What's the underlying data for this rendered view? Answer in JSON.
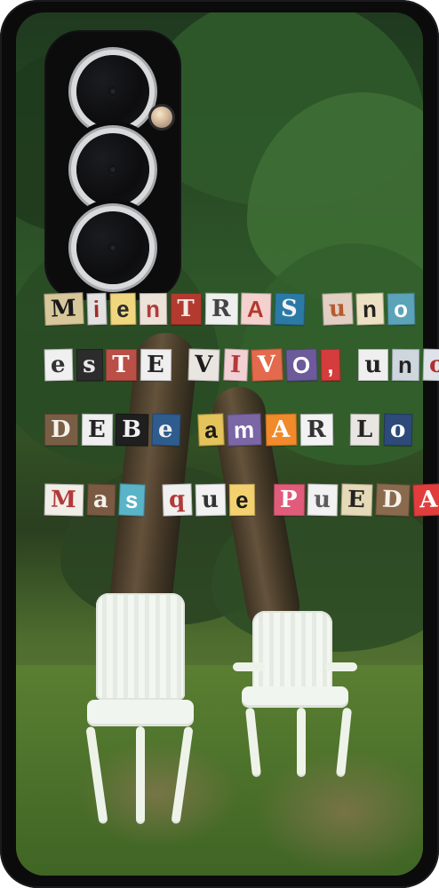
{
  "collage_lines": [
    [
      {
        "text": "M",
        "bg": "#d7c79a",
        "fg": "#1a1a1a",
        "font": "serif"
      },
      {
        "text": "i",
        "bg": "#e2e2e2",
        "fg": "#9d2d2a",
        "font": "sans"
      },
      {
        "text": "e",
        "bg": "#f0d67f",
        "fg": "#2b2b2b",
        "font": "sans"
      },
      {
        "text": "n",
        "bg": "#ece2d7",
        "fg": "#b23a3a",
        "font": "sans"
      },
      {
        "text": "T",
        "bg": "#b33a2f",
        "fg": "#f3e9e4",
        "font": "serif"
      },
      {
        "text": "R",
        "bg": "#efefef",
        "fg": "#444",
        "font": "serif"
      },
      {
        "text": "A",
        "bg": "#f4d1cf",
        "fg": "#b33a2f",
        "font": "sans"
      },
      {
        "text": "S",
        "bg": "#2b7aa6",
        "fg": "#f2f2f2",
        "font": "serif"
      },
      {
        "text": " ",
        "bg": "transparent",
        "fg": "transparent",
        "font": "sans"
      },
      {
        "text": "u",
        "bg": "#e2cfc4",
        "fg": "#b55b32",
        "font": "serif"
      },
      {
        "text": "n",
        "bg": "#ede1c3",
        "fg": "#222",
        "font": "sans"
      },
      {
        "text": "o",
        "bg": "#5aa3b8",
        "fg": "#fff",
        "font": "sans"
      }
    ],
    [
      {
        "text": "e",
        "bg": "#f0f0f0",
        "fg": "#333",
        "font": "serif"
      },
      {
        "text": "s",
        "bg": "#2c2c2c",
        "fg": "#e9e9e9",
        "font": "serif"
      },
      {
        "text": "T",
        "bg": "#b94f47",
        "fg": "#fff",
        "font": "serif"
      },
      {
        "text": "E",
        "bg": "#efefef",
        "fg": "#222",
        "font": "serif"
      },
      {
        "text": " ",
        "bg": "transparent",
        "fg": "transparent",
        "font": "sans"
      },
      {
        "text": "V",
        "bg": "#e9e6e2",
        "fg": "#1c1c1c",
        "font": "serif"
      },
      {
        "text": "I",
        "bg": "#f2d1d4",
        "fg": "#b33a3a",
        "font": "serif"
      },
      {
        "text": "V",
        "bg": "#e36a4c",
        "fg": "#fff",
        "font": "serif"
      },
      {
        "text": "O",
        "bg": "#6d5a9b",
        "fg": "#ffffff",
        "font": "sans"
      },
      {
        "text": ",",
        "bg": "#d53c3c",
        "fg": "#fff",
        "font": "sans"
      },
      {
        "text": " ",
        "bg": "transparent",
        "fg": "transparent",
        "font": "sans"
      },
      {
        "text": "u",
        "bg": "#efefef",
        "fg": "#222",
        "font": "serif"
      },
      {
        "text": "n",
        "bg": "#ced7de",
        "fg": "#222",
        "font": "sans"
      },
      {
        "text": "o",
        "bg": "#dfe3e9",
        "fg": "#b22d2d",
        "font": "serif"
      }
    ],
    [
      {
        "text": "D",
        "bg": "#7a5d45",
        "fg": "#f5f1ea",
        "font": "serif"
      },
      {
        "text": "E",
        "bg": "#efefef",
        "fg": "#222",
        "font": "serif"
      },
      {
        "text": "B",
        "bg": "#1f1f1f",
        "fg": "#f2f2f2",
        "font": "serif"
      },
      {
        "text": "e",
        "bg": "#2f5c8f",
        "fg": "#f0f0f0",
        "font": "serif"
      },
      {
        "text": " ",
        "bg": "transparent",
        "fg": "transparent",
        "font": "sans"
      },
      {
        "text": "a",
        "bg": "#e3c35a",
        "fg": "#1a1a1a",
        "font": "sans"
      },
      {
        "text": "m",
        "bg": "#7b66a6",
        "fg": "#ffffff",
        "font": "sans"
      },
      {
        "text": "A",
        "bg": "#f08a2b",
        "fg": "#fff",
        "font": "serif"
      },
      {
        "text": "R",
        "bg": "#f2f2f2",
        "fg": "#333",
        "font": "serif"
      },
      {
        "text": " ",
        "bg": "transparent",
        "fg": "transparent",
        "font": "sans"
      },
      {
        "text": "L",
        "bg": "#e9e6e2",
        "fg": "#222",
        "font": "serif"
      },
      {
        "text": "o",
        "bg": "#2d4a7b",
        "fg": "#ffffff",
        "font": "serif"
      }
    ],
    [
      {
        "text": "M",
        "bg": "#f1eee8",
        "fg": "#b23a3a",
        "font": "serif"
      },
      {
        "text": "a",
        "bg": "#7a5a43",
        "fg": "#f5f1ea",
        "font": "serif"
      },
      {
        "text": "s",
        "bg": "#5ab4c8",
        "fg": "#fff",
        "font": "sans"
      },
      {
        "text": " ",
        "bg": "transparent",
        "fg": "transparent",
        "font": "sans"
      },
      {
        "text": "q",
        "bg": "#f0f0f0",
        "fg": "#b23a3a",
        "font": "serif"
      },
      {
        "text": "u",
        "bg": "#f2f2f2",
        "fg": "#333",
        "font": "serif"
      },
      {
        "text": "e",
        "bg": "#f3d16f",
        "fg": "#1a1a1a",
        "font": "sans"
      },
      {
        "text": " ",
        "bg": "transparent",
        "fg": "transparent",
        "font": "sans"
      },
      {
        "text": "P",
        "bg": "#e05c7a",
        "fg": "#ffffff",
        "font": "serif"
      },
      {
        "text": "u",
        "bg": "#f2f2f2",
        "fg": "#5c5c5c",
        "font": "serif"
      },
      {
        "text": "E",
        "bg": "#e6d9b7",
        "fg": "#222",
        "font": "serif"
      },
      {
        "text": "D",
        "bg": "#8a6a4d",
        "fg": "#f5f1ea",
        "font": "serif"
      },
      {
        "text": "A",
        "bg": "#e23d3d",
        "fg": "#ffffff",
        "font": "serif"
      }
    ]
  ],
  "colors": {
    "case": "#0b0b0c",
    "foliage_dark": "#21421f",
    "foliage_mid": "#2f5a2a",
    "foliage_light": "#5e8a3c",
    "grass": "#5a7f32",
    "chair": "#f1f5ef"
  },
  "icons": {
    "camera_lens": "camera-lens-icon",
    "flash": "flash-icon"
  }
}
